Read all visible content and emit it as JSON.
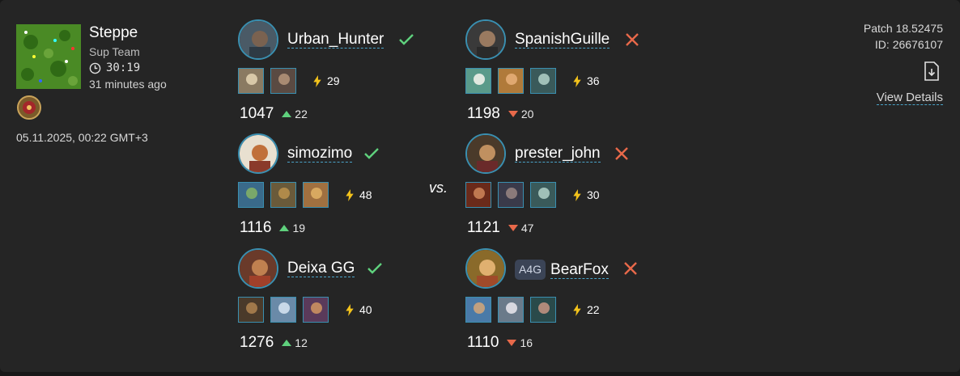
{
  "match": {
    "map_name": "Steppe",
    "game_mode": "Sup Team",
    "duration": "30:19",
    "time_ago": "31 minutes ago",
    "date": "05.11.2025, 00:22 GMT+3",
    "patch": "Patch 18.52475",
    "id": "ID: 26676107",
    "view_details": "View Details",
    "vs_label": "vs."
  },
  "colors": {
    "win": "#5fd17d",
    "loss": "#e8694a",
    "apm": "#f2c21b",
    "accent": "#3a8fb0"
  },
  "team1": [
    {
      "name": "Urban_Hunter",
      "result": "win",
      "apm": "29",
      "elo": "1047",
      "delta": "22",
      "tag": ""
    },
    {
      "name": "simozimo",
      "result": "win",
      "apm": "48",
      "elo": "1116",
      "delta": "19",
      "tag": ""
    },
    {
      "name": "Deixa GG",
      "result": "win",
      "apm": "40",
      "elo": "1276",
      "delta": "12",
      "tag": ""
    }
  ],
  "team2": [
    {
      "name": "SpanishGuille",
      "result": "loss",
      "apm": "36",
      "elo": "1198",
      "delta": "20",
      "tag": ""
    },
    {
      "name": "prester_john",
      "result": "loss",
      "apm": "30",
      "elo": "1121",
      "delta": "47",
      "tag": ""
    },
    {
      "name": "BearFox",
      "result": "loss",
      "apm": "22",
      "elo": "1110",
      "delta": "16",
      "tag": "A4G"
    }
  ],
  "icons": {
    "check": "check-icon",
    "cross": "cross-icon",
    "clock": "clock-icon",
    "bolt": "lightning-icon",
    "download": "download-file-icon"
  }
}
